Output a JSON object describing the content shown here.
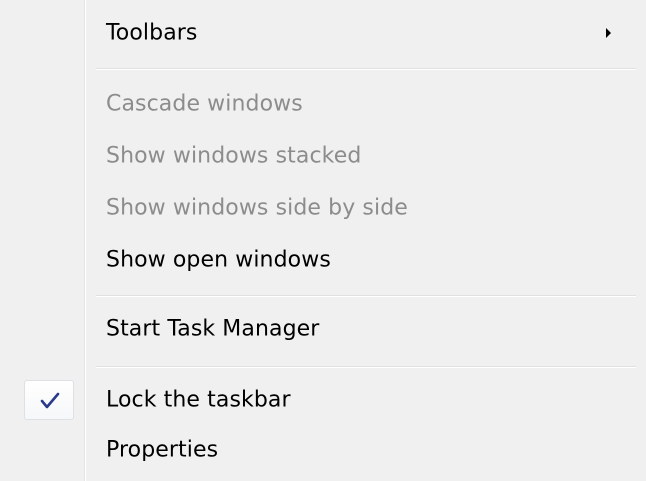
{
  "menu": {
    "items": [
      {
        "label": "Toolbars",
        "enabled": true,
        "has_submenu": true
      },
      {
        "label": "Cascade windows",
        "enabled": false
      },
      {
        "label": "Show windows stacked",
        "enabled": false
      },
      {
        "label": "Show windows side by side",
        "enabled": false
      },
      {
        "label": "Show open windows",
        "enabled": true
      },
      {
        "label": "Start Task Manager",
        "enabled": true
      },
      {
        "label": "Lock the taskbar",
        "enabled": true,
        "checked": true
      },
      {
        "label": "Properties",
        "enabled": true
      }
    ]
  },
  "colors": {
    "menu_background": "#f0f0f0",
    "disabled_text": "#8c8c8c",
    "check_mark": "#2c3a8c"
  },
  "icons": {
    "submenu": "submenu-arrow-icon",
    "check": "checkmark-icon"
  }
}
